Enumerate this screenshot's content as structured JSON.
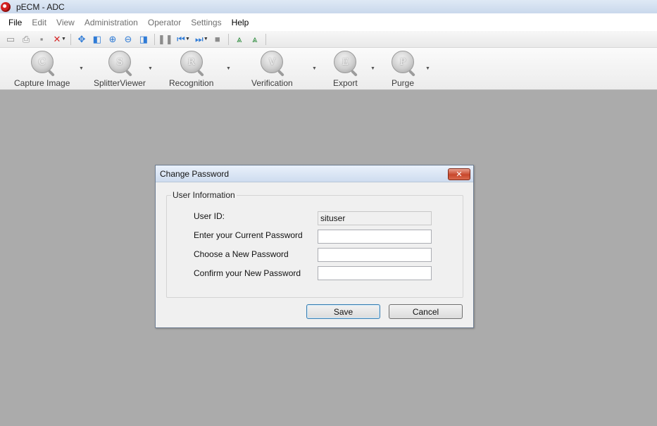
{
  "window": {
    "title": "pECM - ADC"
  },
  "menu": {
    "items": [
      "File",
      "Edit",
      "View",
      "Administration",
      "Operator",
      "Settings",
      "Help"
    ]
  },
  "ribbon": {
    "buttons": [
      {
        "label": "Capture Image",
        "letter": "C"
      },
      {
        "label": "SplitterViewer",
        "letter": "S"
      },
      {
        "label": "Recognition",
        "letter": "R"
      },
      {
        "label": "Verification",
        "letter": "V"
      },
      {
        "label": "Export",
        "letter": "E"
      },
      {
        "label": "Purge",
        "letter": "P"
      }
    ]
  },
  "toolbar": {
    "icons": {
      "open": "▭",
      "print": "⎙",
      "save": "▪",
      "delete": "✕",
      "fit": "✥",
      "prev_page": "◧",
      "zoom_in": "⊕",
      "zoom_out": "⊖",
      "next_page": "◨",
      "pause": "❚❚",
      "first": "⏮",
      "last": "⏭",
      "stop": "■",
      "rotate_left": "⩓",
      "rotate_right": "⩓"
    }
  },
  "dialog": {
    "title": "Change Password",
    "close_glyph": "✕",
    "group_title": "User Information",
    "fields": {
      "user_id": {
        "label": "User ID:",
        "value": "situser"
      },
      "current_password": {
        "label": "Enter your Current Password",
        "value": ""
      },
      "new_password": {
        "label": "Choose a New Password",
        "value": ""
      },
      "confirm_password": {
        "label": "Confirm your New Password",
        "value": ""
      }
    },
    "save_label": "Save",
    "cancel_label": "Cancel"
  },
  "colors": {
    "workspace": "#ababab",
    "close_button": "#c8472c",
    "default_button_border": "#3c7fb1"
  }
}
